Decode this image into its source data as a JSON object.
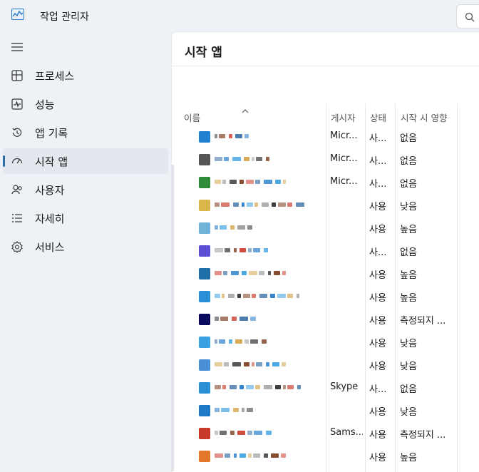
{
  "app": {
    "title": "작업 관리자",
    "icon": "task-manager-icon"
  },
  "search": {
    "icon": "search-icon"
  },
  "sidebar": {
    "items": [
      {
        "label": "프로세스",
        "icon": "processes-icon",
        "active": false
      },
      {
        "label": "성능",
        "icon": "performance-icon",
        "active": false
      },
      {
        "label": "앱 기록",
        "icon": "app-history-icon",
        "active": false
      },
      {
        "label": "시작 앱",
        "icon": "startup-apps-icon",
        "active": true
      },
      {
        "label": "사용자",
        "icon": "users-icon",
        "active": false
      },
      {
        "label": "자세히",
        "icon": "details-icon",
        "active": false
      },
      {
        "label": "서비스",
        "icon": "services-icon",
        "active": false
      }
    ]
  },
  "main": {
    "title": "시작 앱",
    "columns": [
      "이름",
      "게시자",
      "상태",
      "시작 시 영향"
    ],
    "rows": [
      {
        "publisher": "Micr...",
        "status": "사...",
        "impact": "없음",
        "icon_color": "#1f7fd1"
      },
      {
        "publisher": "Micr...",
        "status": "사...",
        "impact": "없음",
        "icon_color": "#555555"
      },
      {
        "publisher": "Micr...",
        "status": "사...",
        "impact": "없음",
        "icon_color": "#2e8b3a"
      },
      {
        "publisher": "",
        "status": "사용",
        "impact": "낮음",
        "icon_color": "#d9b54a"
      },
      {
        "publisher": "",
        "status": "사용",
        "impact": "높음",
        "icon_color": "#6fb3d8"
      },
      {
        "publisher": "",
        "status": "사...",
        "impact": "없음",
        "icon_color": "#5b4fd6"
      },
      {
        "publisher": "",
        "status": "사용",
        "impact": "높음",
        "icon_color": "#1f6fa8"
      },
      {
        "publisher": "",
        "status": "사용",
        "impact": "높음",
        "icon_color": "#2a8fd6"
      },
      {
        "publisher": "",
        "status": "사용",
        "impact": "측정되지 ...",
        "icon_color": "#0a0a5e"
      },
      {
        "publisher": "",
        "status": "사용",
        "impact": "낮음",
        "icon_color": "#3aa0e0"
      },
      {
        "publisher": "",
        "status": "사용",
        "impact": "낮음",
        "icon_color": "#4a90d9"
      },
      {
        "publisher": "Skype",
        "status": "사...",
        "impact": "없음",
        "icon_color": "#2b8fd4"
      },
      {
        "publisher": "",
        "status": "사용",
        "impact": "낮음",
        "icon_color": "#1f78c8"
      },
      {
        "publisher": "Sams...",
        "status": "사용",
        "impact": "측정되지 ...",
        "icon_color": "#c93a2a"
      },
      {
        "publisher": "",
        "status": "사용",
        "impact": "높음",
        "icon_color": "#e3782a"
      }
    ]
  }
}
